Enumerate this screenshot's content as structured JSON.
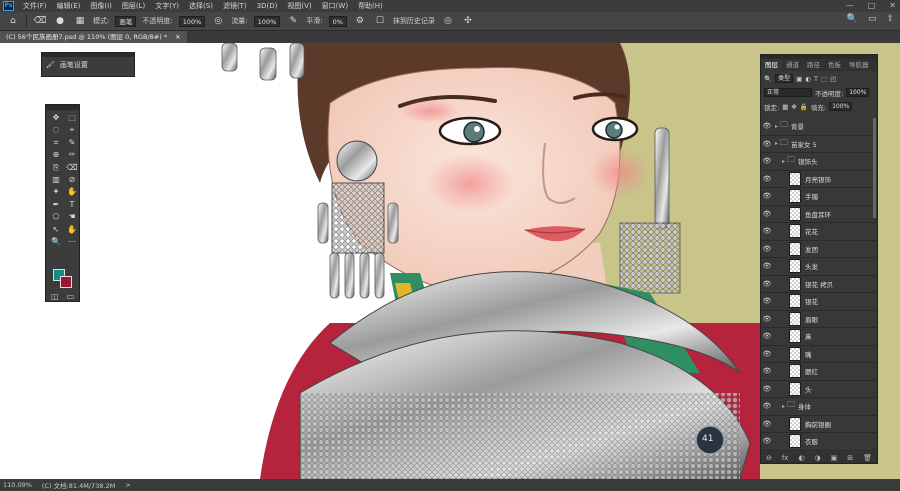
{
  "app": {
    "logo_text": "Ps"
  },
  "menubar": {
    "items": [
      "文件(F)",
      "编辑(E)",
      "图像(I)",
      "图层(L)",
      "文字(Y)",
      "选择(S)",
      "滤镜(T)",
      "3D(D)",
      "视图(V)",
      "窗口(W)",
      "帮助(H)"
    ],
    "minimize": "—",
    "maximize": "□",
    "close": "✕"
  },
  "options": {
    "mode_label": "模式:",
    "mode_value": "画笔",
    "opacity_label": "不透明度:",
    "opacity_value": "100%",
    "flow_label": "流量:",
    "flow_value": "100%",
    "smoothing_label": "平滑:",
    "smoothing_value": "0%",
    "history_label": "抹到历史记录"
  },
  "document": {
    "tab_title": "(C) 56个民族画册7.psd @ 110% (图层 0, RGB/8#) *",
    "close": "✕"
  },
  "status": {
    "zoom": "110.09%",
    "doc_info": "(C) 文档:81.4M/738.2M",
    "arrow": ">"
  },
  "brush_panel": {
    "title": "画笔设置"
  },
  "toolbox": {
    "tools": [
      "✥",
      "⬚",
      "◌",
      "⌖",
      "⌗",
      "✎",
      "⊕",
      "✑",
      "⎘",
      "⌫",
      "▥",
      "⊘",
      "✦",
      "✋",
      "✒",
      "T",
      "⬠",
      "☚",
      "↖",
      "✋",
      "🔍",
      "⋯"
    ],
    "fg_color": "#0f8f86",
    "bg_color": "#9c1633"
  },
  "layers_panel": {
    "tabs": [
      "图层",
      "通道",
      "路径",
      "色板",
      "导航器"
    ],
    "kind_label": "类型",
    "blend_mode": "正常",
    "opacity_label": "不透明度:",
    "opacity_value": "100%",
    "lock_label": "锁定:",
    "fill_label": "填充:",
    "fill_value": "100%",
    "layers": [
      {
        "name": "背景",
        "type": "group",
        "indent": 0
      },
      {
        "name": "苗家女 5",
        "type": "group",
        "indent": 0
      },
      {
        "name": "银饰头",
        "type": "group",
        "indent": 1
      },
      {
        "name": "月亮银饰",
        "type": "layer",
        "indent": 2
      },
      {
        "name": "手镯",
        "type": "layer",
        "indent": 2
      },
      {
        "name": "鱼盘耳环",
        "type": "layer",
        "indent": 2
      },
      {
        "name": "花花",
        "type": "layer",
        "indent": 2
      },
      {
        "name": "发团",
        "type": "layer",
        "indent": 2
      },
      {
        "name": "头发",
        "type": "layer",
        "indent": 2
      },
      {
        "name": "银花 拷贝",
        "type": "layer",
        "indent": 2
      },
      {
        "name": "银花",
        "type": "layer",
        "indent": 2
      },
      {
        "name": "眉眼",
        "type": "layer",
        "indent": 2
      },
      {
        "name": "鼻",
        "type": "layer",
        "indent": 2
      },
      {
        "name": "嘴",
        "type": "layer",
        "indent": 2
      },
      {
        "name": "腮红",
        "type": "layer",
        "indent": 2
      },
      {
        "name": "头",
        "type": "layer",
        "indent": 2
      },
      {
        "name": "身体",
        "type": "group",
        "indent": 1
      },
      {
        "name": "胸前银圈",
        "type": "layer",
        "indent": 2
      },
      {
        "name": "衣服",
        "type": "layer",
        "indent": 2
      }
    ],
    "footer_icons": [
      "⊖",
      "fx",
      "◐",
      "◑",
      "▣",
      "⊞",
      "🗑"
    ]
  },
  "hud": {
    "value": "41"
  }
}
